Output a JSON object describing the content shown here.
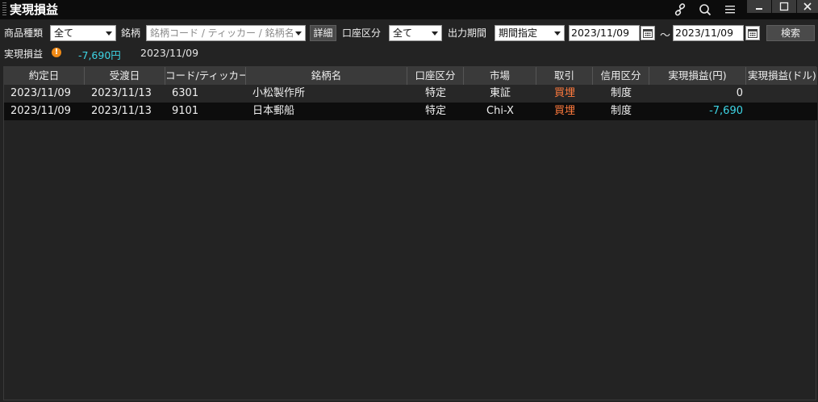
{
  "window": {
    "title": "実現損益"
  },
  "filters": {
    "product_type_label": "商品種類",
    "product_type_value": "全て",
    "symbol_label": "銘柄",
    "symbol_placeholder": "銘柄コード / ティッカー / 銘柄名",
    "detail_button": "詳細",
    "account_label": "口座区分",
    "account_value": "全て",
    "period_label": "出力期間",
    "period_value": "期間指定",
    "date_from": "2023/11/09",
    "date_sep": "～",
    "date_to": "2023/11/09",
    "search_button": "検索"
  },
  "summary": {
    "label": "実現損益",
    "value": "-7,690円",
    "date": "2023/11/09"
  },
  "table": {
    "columns": [
      "約定日",
      "受渡日",
      "コード/ティッカー",
      "銘柄名",
      "口座区分",
      "市場",
      "取引",
      "信用区分",
      "実現損益(円)",
      "実現損益(ドル)"
    ],
    "rows": [
      [
        "2023/11/09",
        "2023/11/13",
        "6301",
        "小松製作所",
        "特定",
        "東証",
        "買埋",
        "制度",
        "0",
        ""
      ],
      [
        "2023/11/09",
        "2023/11/13",
        "9101",
        "日本郵船",
        "特定",
        "Chi-X",
        "買埋",
        "制度",
        "-7,690",
        ""
      ]
    ]
  },
  "colors": {
    "trade_text": "#ff7a3d",
    "negative_value": "#3ed6e6",
    "warning": "#f08a16"
  },
  "icons": {
    "link": "link-icon",
    "search": "search-icon",
    "menu": "menu-icon",
    "minimize": "minimize-icon",
    "maximize": "maximize-icon",
    "close": "close-icon",
    "calendar": "calendar-icon",
    "warning": "warning-icon"
  }
}
